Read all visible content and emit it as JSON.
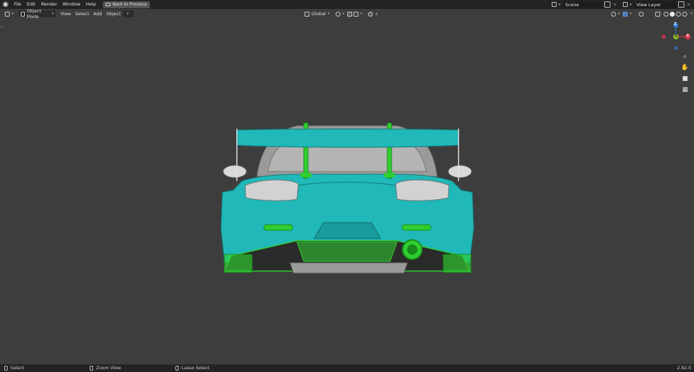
{
  "topbar": {
    "menus": [
      "File",
      "Edit",
      "Render",
      "Window",
      "Help"
    ],
    "back_button": "Back to Previous",
    "scene": "Scene",
    "view_layer": "View Layer"
  },
  "viewport_header": {
    "mode": "Object Mode",
    "menus": [
      "View",
      "Select",
      "Add",
      "Object"
    ],
    "transform_orientation": "Global"
  },
  "gizmo": {
    "z_label": "Z",
    "y_label": "Y",
    "x_label": "X",
    "colors": {
      "x": "#e4334d",
      "y": "#7fc224",
      "z": "#2f7fe0"
    }
  },
  "statusbar": {
    "select": "Select",
    "zoom_view": "Zoom View",
    "lasso_select": "Lasso Select",
    "version": "2.92.0"
  },
  "viewport": {
    "background": "#3d3d3d",
    "colors": {
      "selected_body": "#20b8b8",
      "active_part": "#2fcf2f",
      "unselected": "#cfcfcf"
    }
  }
}
